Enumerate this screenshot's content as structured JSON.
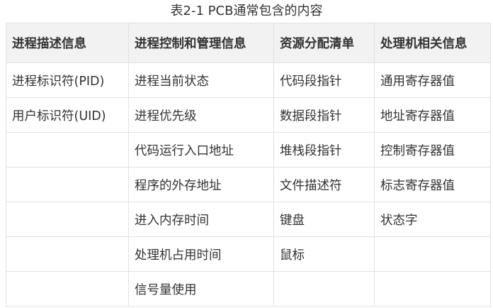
{
  "caption": "表2-1 PCB通常包含的内容",
  "table": {
    "headers": [
      "进程描述信息",
      "进程控制和管理信息",
      "资源分配清单",
      "处理机相关信息"
    ],
    "rows": [
      [
        "进程标识符(PID)",
        "进程当前状态",
        "代码段指针",
        "通用寄存器值"
      ],
      [
        "用户标识符(UID)",
        "进程优先级",
        "数据段指针",
        "地址寄存器值"
      ],
      [
        "",
        "代码运行入口地址",
        "堆栈段指针",
        "控制寄存器值"
      ],
      [
        "",
        "程序的外存地址",
        "文件描述符",
        "标志寄存器值"
      ],
      [
        "",
        "进入内存时间",
        "键盘",
        "状态字"
      ],
      [
        "",
        "处理机占用时间",
        "鼠标",
        ""
      ],
      [
        "",
        "信号量使用",
        "",
        ""
      ]
    ]
  }
}
